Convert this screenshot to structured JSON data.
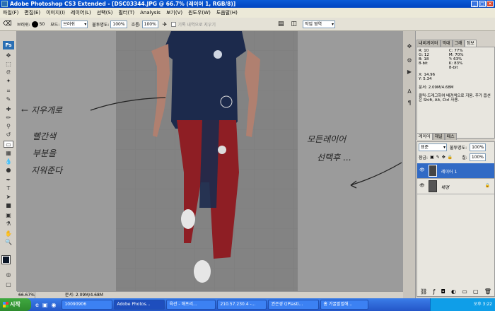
{
  "titlebar": {
    "title": "Adobe Photoshop CS3 Extended - [DSC03344.JPG @ 66.7% (레이어 1, RGB/8)]"
  },
  "menu": [
    "파일(F)",
    "편집(E)",
    "이미지(I)",
    "레이어(L)",
    "선택(S)",
    "필터(T)",
    "Analysis",
    "보기(V)",
    "윈도우(W)",
    "도움말(H)"
  ],
  "options": {
    "brush_label": "브러쉬:",
    "brush_size": "50",
    "mode_label": "모드:",
    "mode_value": "브러쉬",
    "opacity_label": "불투명도:",
    "opacity_value": "100%",
    "flow_label": "흐름:",
    "flow_value": "100%",
    "history_label": "기록 내역으로 지우기",
    "workspace": "작업 영역"
  },
  "canvas": {
    "zoom": "66.67%",
    "doc_info": "문서: 2.09M/4.68M"
  },
  "panels": {
    "tabs_top": [
      "내비게이터",
      "막대",
      "그래",
      "정보"
    ],
    "info": {
      "r": "10",
      "g": "12",
      "b": "18",
      "c": "77%",
      "m": "70%",
      "y": "63%",
      "k": "83%",
      "bit1": "8-bit",
      "bit2": "8-bit",
      "x": "14.96",
      "yv": "5.34",
      "doc": "문서: 2.09M/4.68M",
      "hint": "클릭-드래그하여 배경색으로 지움. 추가 옵션은 Shift, Alt, Ctrl 사용."
    },
    "layer_tabs": [
      "레이어",
      "채널",
      "패스"
    ],
    "blend": "표준",
    "opacity_label": "불투명도:",
    "opacity": "100%",
    "lock_label": "잠금:",
    "fill_label": "칠:",
    "fill": "100%",
    "layers": [
      {
        "name": "레이어 1",
        "selected": true
      },
      {
        "name": "배경",
        "selected": false
      }
    ]
  },
  "annotations": {
    "left1": "← 지우개로",
    "left2": "빨간색",
    "left3": "부분을",
    "left4": "지워준다",
    "right1": "모든레이어",
    "right2": "선택후 ..."
  },
  "taskbar": {
    "start": "시작",
    "items": [
      "10090906",
      "Adobe Photos...",
      "육션 - 해프리...",
      "210.57.230.4 -...",
      "권은경 ((Plasti...",
      "홈 가꿀팔멀해..."
    ],
    "clock": "오후 3:22"
  }
}
